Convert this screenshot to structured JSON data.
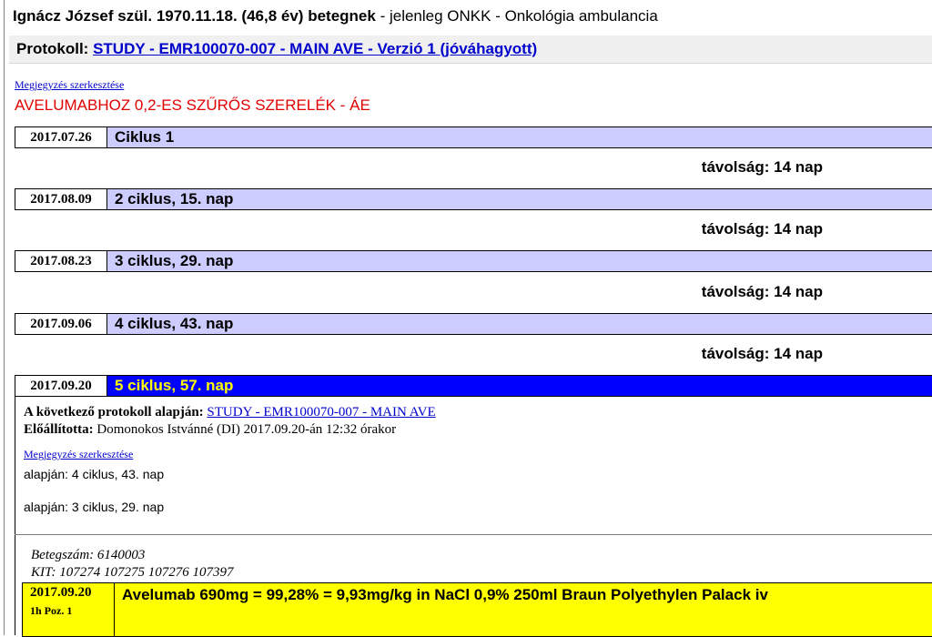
{
  "header": {
    "patient_name": "Ignácz József",
    "birth_label": "szül.",
    "birth_date": "1970.11.18.",
    "age": "(46,8 év)",
    "role": "betegnek",
    "location": "- jelenleg ONKK - Onkológia ambulancia"
  },
  "protocol": {
    "label": "Protokoll:",
    "link_text": "STUDY - EMR100070-007 - MAIN AVE - Verzió 1 (jóváhagyott)"
  },
  "note": {
    "edit_link": "Megjegyzés szerkesztése",
    "text": "AVELUMABHOZ 0,2-ES SZŰRŐS SZERELÉK - ÁE"
  },
  "cycles": [
    {
      "date": "2017.07.26",
      "label": "Ciklus 1",
      "distance": "távolság: 14 nap"
    },
    {
      "date": "2017.08.09",
      "label": "2 ciklus, 15. nap",
      "distance": "távolság: 14 nap"
    },
    {
      "date": "2017.08.23",
      "label": "3 ciklus, 29. nap",
      "distance": "távolság: 14 nap"
    },
    {
      "date": "2017.09.06",
      "label": "4 ciklus, 43. nap",
      "distance": "távolság: 14 nap"
    },
    {
      "date": "2017.09.20",
      "label": "5 ciklus, 57. nap"
    }
  ],
  "detail": {
    "based_on_label": "A következő protokoll alapján:",
    "based_on_link": "STUDY - EMR100070-007 - MAIN AVE",
    "created_label": "Előállította:",
    "created_value": "Domonokos Istvánné (DI) 2017.09.20-án 12:32 órakor",
    "edit_link": "Megjegyzés szerkesztése",
    "basis_1": "alapján: 4 ciklus, 43. nap",
    "basis_2": "alapján: 3 ciklus, 29. nap",
    "patient_no": "Betegszám: 6140003",
    "kit": "KIT: 107274 107275 107276 107397"
  },
  "dose": {
    "date": "2017.09.20",
    "sub": "1h  Poz. 1",
    "text": "Avelumab 690mg = 99,28% = 9,93mg/kg in NaCl 0,9% 250ml Braun Polyethylen Palack iv"
  }
}
